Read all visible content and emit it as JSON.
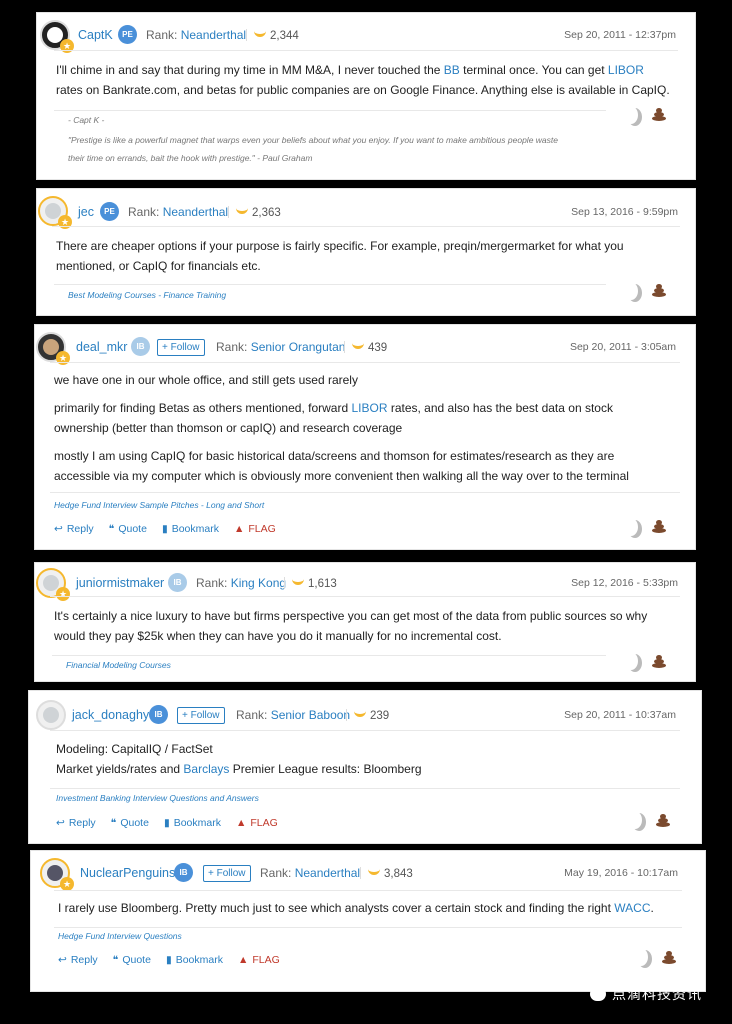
{
  "posts": [
    {
      "username": "CaptK",
      "badge": "PE",
      "rank_label": "Rank:",
      "rank": "Neanderthal",
      "bananas": "2,344",
      "date": "Sep 20, 2011 - 12:37pm",
      "body_parts": [
        "I'll chime in and say that during my time in MM M&A, I never touched the ",
        "BB",
        " terminal once. You can get ",
        "LIBOR",
        "rates on Bankrate.com, and betas for public companies are on Google Finance. Anything else is available in CapIQ."
      ],
      "sig_name": "- Capt K -",
      "sig_quote": "\"Prestige is like a powerful magnet that warps even your beliefs about what you enjoy. If you want to make ambitious people waste",
      "sig_quote2": "their time on errands, bait the hook with prestige.\" - Paul Graham"
    },
    {
      "username": "jec",
      "badge": "PE",
      "rank_label": "Rank:",
      "rank": "Neanderthal",
      "bananas": "2,363",
      "date": "Sep 13, 2016 - 9:59pm",
      "body1": "There are cheaper options if your purpose is fairly specific. For example, preqin/mergermarket for what you",
      "body2": "mentioned, or CapIQ for financials etc.",
      "sig_link": "Best Modeling Courses - Finance Training"
    },
    {
      "username": "deal_mkr",
      "badge": "IB",
      "follow": "+ Follow",
      "rank_label": "Rank:",
      "rank": "Senior Orangutan",
      "bananas": "439",
      "date": "Sep 20, 2011 - 3:05am",
      "p1": "we have one in our whole office, and still gets used rarely",
      "p2_parts": [
        "primarily for finding Betas as others mentioned, forward ",
        "LIBOR",
        " rates, and also has the best data on stock"
      ],
      "p2b": "ownership (better than thomson or capIQ) and research coverage",
      "p3a": "mostly I am using CapIQ for basic historical data/screens and thomson for estimates/research as they are",
      "p3b": "accessible via my computer which is obviously more convenient then walking all the way over to the terminal",
      "sig_link": "Hedge Fund Interview Sample Pitches - Long and Short"
    },
    {
      "username": "juniormistmaker",
      "badge": "IB",
      "rank_label": "Rank:",
      "rank": "King Kong",
      "bananas": "1,613",
      "date": "Sep 12, 2016 - 5:33pm",
      "body1": "It's certainly a nice luxury to have but firms perspective you can get most of the data from public sources so why",
      "body2": "would they pay $25k when they can have you do it manually for no incremental cost.",
      "sig_link": "Financial Modeling Courses"
    },
    {
      "username": "jack_donaghy",
      "badge": "IB",
      "follow": "+ Follow",
      "rank_label": "Rank:",
      "rank": "Senior Baboon",
      "bananas": "239",
      "date": "Sep 20, 2011 - 10:37am",
      "body1": "Modeling: CapitalIQ / FactSet",
      "body2_parts": [
        "Market yields/rates and ",
        "Barclays",
        " Premier League results: Bloomberg"
      ],
      "sig_link": "Investment Banking Interview Questions and Answers"
    },
    {
      "username": "NuclearPenguins",
      "badge": "IB",
      "follow": "+ Follow",
      "rank_label": "Rank:",
      "rank": "Neanderthal",
      "bananas": "3,843",
      "date": "May 19, 2016 - 10:17am",
      "body_parts": [
        "I rarely use Bloomberg. Pretty much just to see which analysts cover a certain stock and finding the right ",
        "WACC",
        "."
      ],
      "sig_link": "Hedge Fund Interview Questions"
    }
  ],
  "actions": {
    "reply": "Reply",
    "quote": "Quote",
    "bookmark": "Bookmark",
    "flag": "FLAG"
  },
  "watermark": "点滴科技资讯",
  "colors": {
    "link": "#2a7fc1",
    "banana": "#f5b82e",
    "flag": "#c0392b"
  }
}
